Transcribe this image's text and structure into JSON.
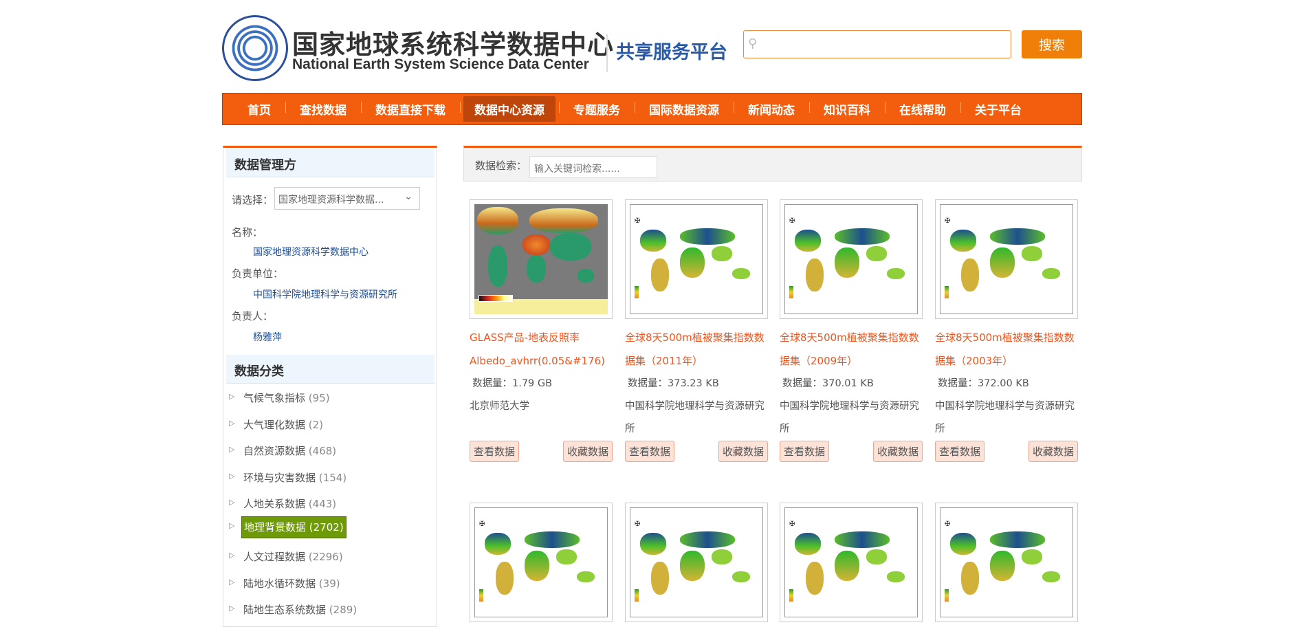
{
  "header": {
    "logo_cn": "国家地球系统科学数据中心",
    "logo_en": "National Earth System Science Data Center",
    "platform": "共享服务平台",
    "search_button": "搜索",
    "search_value": ""
  },
  "nav": [
    "首页",
    "查找数据",
    "数据直接下载",
    "数据中心资源",
    "专题服务",
    "国际数据资源",
    "新闻动态",
    "知识百科",
    "在线帮助",
    "关于平台"
  ],
  "nav_active": "数据中心资源",
  "sidebar": {
    "manager_title": "数据管理方",
    "select_label": "请选择：",
    "select_value": "国家地理资源科学数据...",
    "name_label": "名称：",
    "name_value": "国家地理资源科学数据中心",
    "unit_label": "负责单位：",
    "unit_value": "中国科学院地理科学与资源研究所",
    "person_label": "负责人：",
    "person_value": "杨雅萍",
    "category_title": "数据分类",
    "categories": [
      {
        "name": "气候气象指标",
        "count": "(95)"
      },
      {
        "name": "大气理化数据",
        "count": "(2)"
      },
      {
        "name": "自然资源数据",
        "count": "(468)"
      },
      {
        "name": "环境与灾害数据",
        "count": "(154)"
      },
      {
        "name": "人地关系数据",
        "count": "(443)"
      },
      {
        "name": "地理背景数据",
        "count": "(2702)",
        "active": true
      },
      {
        "name": "人文过程数据",
        "count": "(2296)"
      },
      {
        "name": "陆地水循环数据",
        "count": "(39)"
      },
      {
        "name": "陆地生态系统数据",
        "count": "(289)"
      }
    ]
  },
  "main": {
    "search_label": "数据检索：",
    "search_placeholder": "输入关键词检索......",
    "view_label": "查看数据",
    "fav_label": "收藏数据",
    "cards": [
      {
        "title": "GLASS产品-地表反照率Albedo_avhrr(0.05&#176)",
        "size": "数据量：1.79 GB",
        "org": "北京师范大学",
        "thumb": "glass"
      },
      {
        "title": "全球8天500m植被聚集指数数据集（2011年）",
        "size": "数据量：373.23 KB",
        "org": "中国科学院地理科学与资源研究所",
        "thumb": "map"
      },
      {
        "title": "全球8天500m植被聚集指数数据集（2009年）",
        "size": "数据量：370.01 KB",
        "org": "中国科学院地理科学与资源研究所",
        "thumb": "map"
      },
      {
        "title": "全球8天500m植被聚集指数数据集（2003年）",
        "size": "数据量：372.00 KB",
        "org": "中国科学院地理科学与资源研究所",
        "thumb": "map"
      }
    ],
    "row2_thumbs": [
      "map",
      "map",
      "map",
      "map"
    ]
  }
}
